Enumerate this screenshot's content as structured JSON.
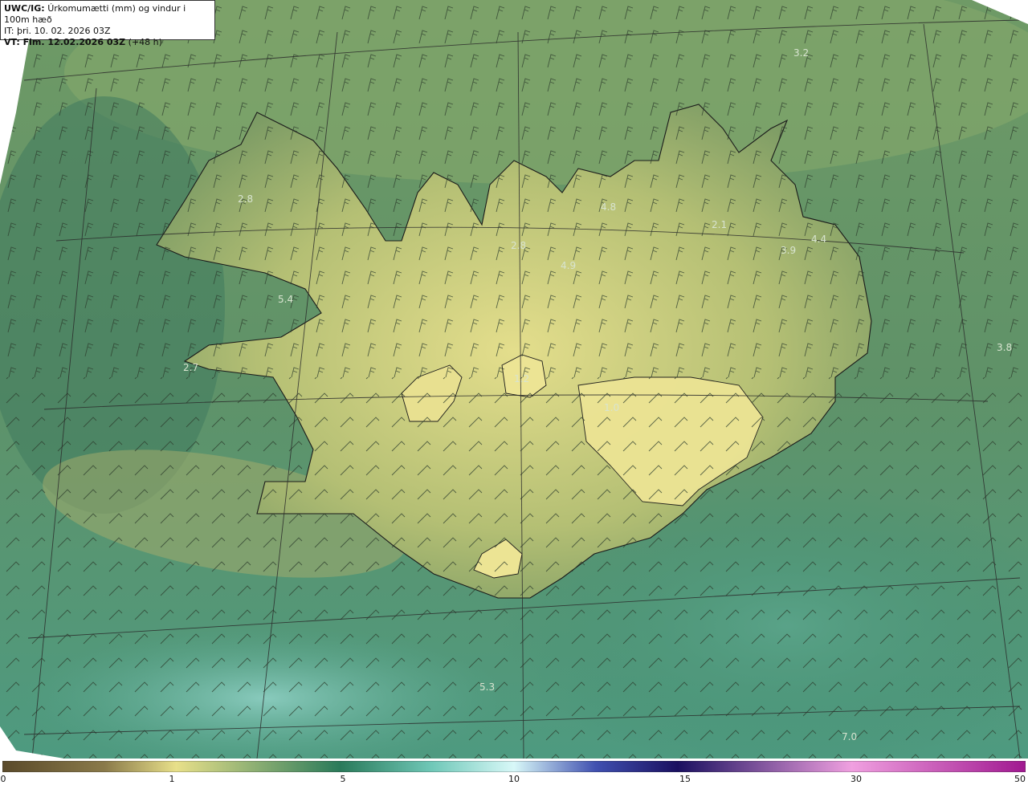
{
  "header": {
    "product_label": "UWC/IG:",
    "title": "Úrkomumætti (mm) og vindur i 100m hæð",
    "issue_time": "IT: þri. 10. 02. 2026 03Z",
    "valid_label": "VT: Fim. 12.02.2026 03Z",
    "valid_offset": "(+48 h)"
  },
  "map_labels": [
    {
      "id": "v1",
      "text": "3.2"
    },
    {
      "id": "v2",
      "text": "2.8"
    },
    {
      "id": "v3",
      "text": "4.8"
    },
    {
      "id": "v4",
      "text": "2.1"
    },
    {
      "id": "v5",
      "text": "4.4"
    },
    {
      "id": "v6",
      "text": "4.9"
    },
    {
      "id": "v7",
      "text": "5.4"
    },
    {
      "id": "v8",
      "text": "3.8"
    },
    {
      "id": "v9",
      "text": "2.7"
    },
    {
      "id": "v10",
      "text": "1.0"
    },
    {
      "id": "v11",
      "text": "5.3"
    },
    {
      "id": "v12",
      "text": "7.0"
    },
    {
      "id": "v13",
      "text": "2.8"
    },
    {
      "id": "v14",
      "text": "3.9"
    },
    {
      "id": "v15",
      "text": "1.2"
    }
  ],
  "colorbar": {
    "ticks": [
      "0",
      "1",
      "5",
      "10",
      "15",
      "30",
      "50"
    ],
    "colors": [
      "#5a4a2a",
      "#a89a60",
      "#e8e08a",
      "#2a7a5a",
      "#60c0b0",
      "#c0f0f0",
      "#3040a0",
      "#1a1060",
      "#e080d0",
      "#b020a0"
    ]
  },
  "colors": {
    "sea_dark": "#2e7a64",
    "sea_mid": "#4e8a6a",
    "land_light": "#d8d88a",
    "land_mid": "#a8b870",
    "teal_light": "#7ab8a0"
  }
}
